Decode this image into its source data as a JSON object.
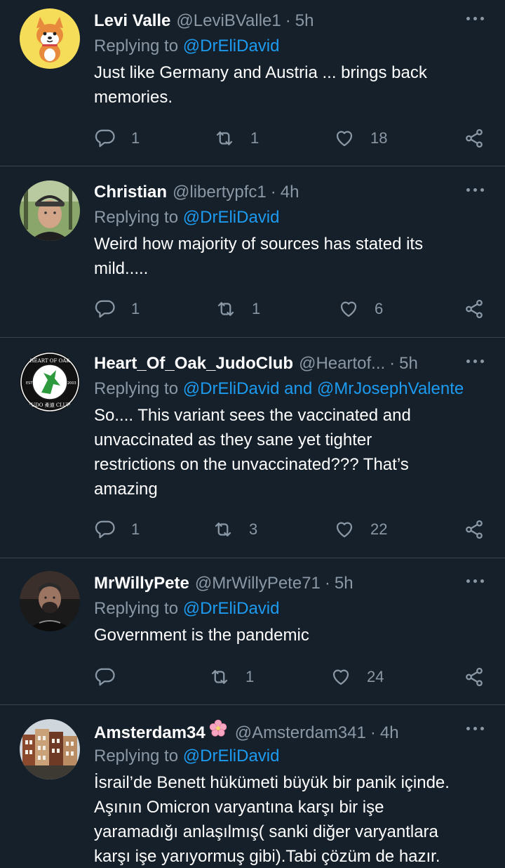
{
  "tweets": [
    {
      "name": "Levi Valle",
      "handle": "@LeviBValle1",
      "time": "5h",
      "replying_prefix": "Replying to ",
      "replying_to": "@DrEliDavid",
      "text_lines": [
        "Just like Germany and Austria ... brings back",
        "memories."
      ],
      "counts": {
        "reply": "1",
        "retweet": "1",
        "like": "18"
      }
    },
    {
      "name": "Christian",
      "handle": "@libertypfc1",
      "time": "4h",
      "replying_prefix": "Replying to ",
      "replying_to": "@DrEliDavid",
      "text_lines": [
        "Weird how majority of sources has stated its",
        "mild....."
      ],
      "counts": {
        "reply": "1",
        "retweet": "1",
        "like": "6"
      }
    },
    {
      "name": "Heart_Of_Oak_JudoClub",
      "handle": "@Heartof...",
      "time": "5h",
      "replying_prefix": "Replying to ",
      "replying_to": "@DrEliDavid and @MrJosephValente",
      "text_lines": [
        "So.... This variant sees the vaccinated and",
        "unvaccinated as they sane yet tighter",
        "restrictions on the unvaccinated??? That’s",
        "amazing"
      ],
      "counts": {
        "reply": "1",
        "retweet": "3",
        "like": "22"
      },
      "avatar_text": {
        "top": "HEART OF OAK",
        "bottom": "JUDO 柔道 CLUB",
        "left": "EST",
        "right": "2003"
      }
    },
    {
      "name": "MrWillyPete",
      "handle": "@MrWillyPete71",
      "time": "5h",
      "replying_prefix": "Replying to ",
      "replying_to": "@DrEliDavid",
      "text_lines": [
        "Government is the pandemic"
      ],
      "counts": {
        "reply": "",
        "retweet": "1",
        "like": "24"
      }
    },
    {
      "name": "Amsterdam34",
      "handle": "@Amsterdam341",
      "time": "4h",
      "replying_prefix": "Replying to ",
      "replying_to": "@DrEliDavid",
      "text_lines": [
        "İsrail’de Benett hükümeti büyük bir panik içinde.",
        "Aşının Omicron varyantına karşı bir işe",
        "yaramadığı anlaşılmış( sanki diğer varyantlara",
        "karşı işe yarıyormuş gibi).Tabi çözüm de hazır."
      ],
      "counts": {
        "reply": "",
        "retweet": "",
        "like": ""
      }
    }
  ],
  "separator": "·",
  "icons": {
    "reply": "reply-icon",
    "retweet": "retweet-icon",
    "like": "heart-icon",
    "share": "share-icon",
    "more": "more-icon"
  },
  "colors": {
    "background": "#15202b",
    "text": "#ffffff",
    "muted": "#8b98a5",
    "link": "#1d9bf0",
    "divider": "#38444d"
  }
}
